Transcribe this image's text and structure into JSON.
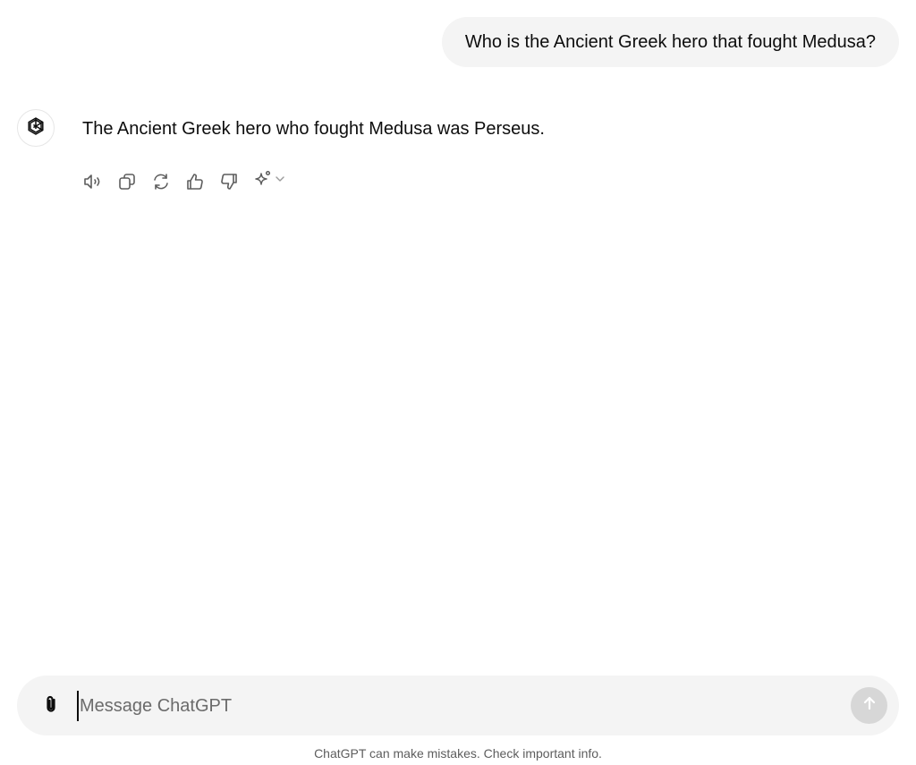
{
  "conversation": {
    "user_message": "Who is the Ancient Greek hero that fought Medusa?",
    "assistant_message": "The Ancient Greek hero who fought Medusa was Perseus."
  },
  "assistant_actions": [
    {
      "name": "read-aloud-icon"
    },
    {
      "name": "copy-icon"
    },
    {
      "name": "regenerate-icon"
    },
    {
      "name": "thumbs-up-icon"
    },
    {
      "name": "thumbs-down-icon"
    },
    {
      "name": "sparkle-icon"
    }
  ],
  "composer": {
    "placeholder": "Message ChatGPT",
    "value": ""
  },
  "footer": {
    "disclaimer": "ChatGPT can make mistakes. Check important info."
  },
  "colors": {
    "bubble_bg": "#f4f4f4",
    "text": "#0d0d0d",
    "icon": "#5d5d5d",
    "send_disabled": "#d7d7d7"
  }
}
